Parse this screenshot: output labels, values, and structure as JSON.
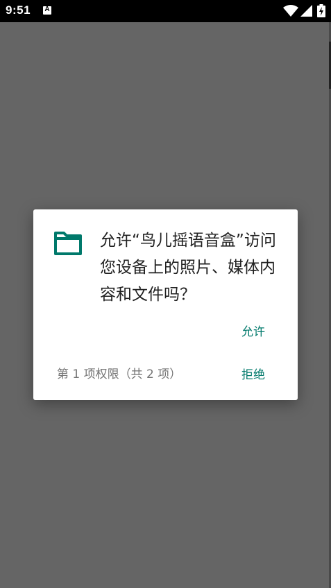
{
  "status_bar": {
    "time": "9:51",
    "notification_letter": "A",
    "icons": [
      "wifi-icon",
      "signal-icon",
      "battery-icon"
    ]
  },
  "dialog": {
    "icon": "folder-icon",
    "message": "允许“鸟儿摇语音盒”访问您设备上的照片、媒体内容和文件吗？",
    "allow_label": "允许",
    "permission_count": "第 1 项权限（共 2 项）",
    "deny_label": "拒绝"
  },
  "colors": {
    "accent": "#00796b",
    "scrim": "#656565",
    "text_primary": "#212121",
    "text_secondary": "#757575"
  }
}
